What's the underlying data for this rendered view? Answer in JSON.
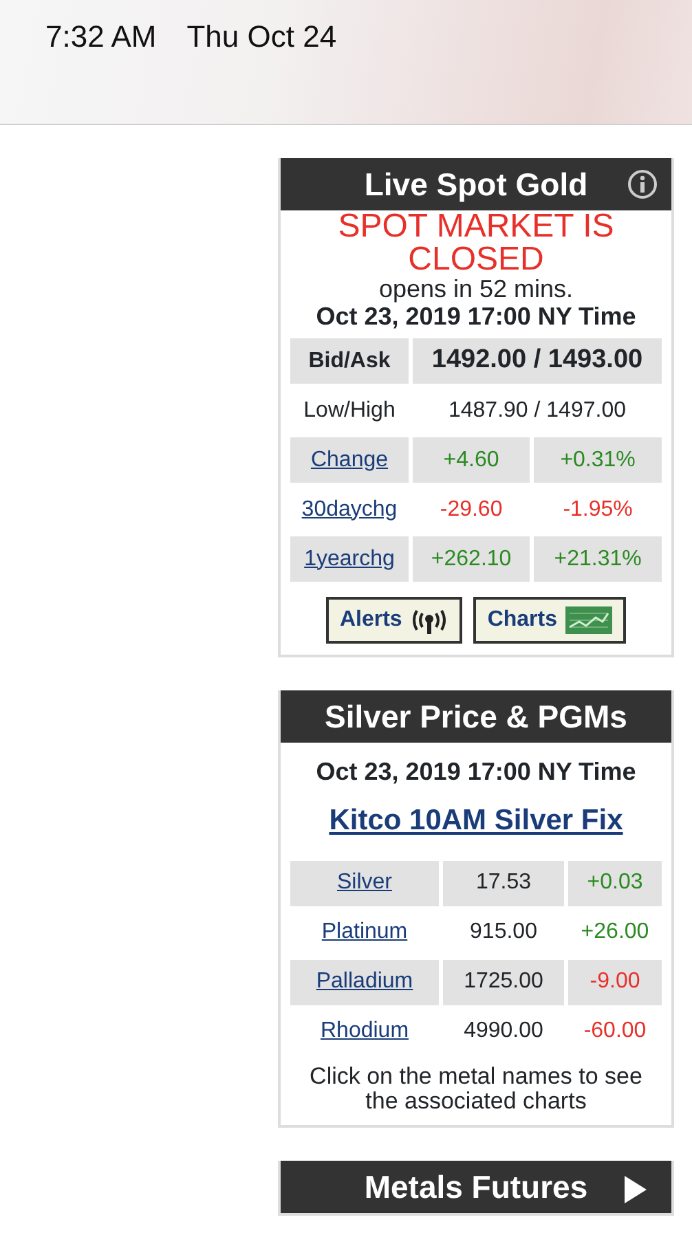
{
  "status_bar": {
    "time": "7:32 AM",
    "date": "Thu Oct 24"
  },
  "gold": {
    "title": "Live Spot Gold",
    "market_status": "SPOT MARKET IS CLOSED",
    "opens_in": "opens in 52 mins.",
    "timestamp": "Oct 23, 2019 17:00 NY Time",
    "rows": [
      {
        "kind": "span",
        "label": "Bid/Ask",
        "link": false,
        "bold": true,
        "value": "1492.00 / 1493.00"
      },
      {
        "kind": "span",
        "label": "Low/High",
        "link": false,
        "bold": false,
        "value": "1487.90 / 1497.00"
      },
      {
        "kind": "split",
        "label": "Change",
        "link": true,
        "values": [
          {
            "text": "+4.60",
            "color": "#2b8a22"
          },
          {
            "text": "+0.31%",
            "color": "#2b8a22"
          }
        ]
      },
      {
        "kind": "split",
        "label": "30daychg",
        "link": true,
        "values": [
          {
            "text": "-29.60",
            "color": "#e8302a"
          },
          {
            "text": "-1.95%",
            "color": "#e8302a"
          }
        ]
      },
      {
        "kind": "split",
        "label": "1yearchg",
        "link": true,
        "values": [
          {
            "text": "+262.10",
            "color": "#2b8a22"
          },
          {
            "text": "+21.31%",
            "color": "#2b8a22"
          }
        ]
      }
    ],
    "buttons": [
      {
        "label": "Alerts",
        "kind": "alerts"
      },
      {
        "label": "Charts",
        "kind": "charts"
      }
    ]
  },
  "silver": {
    "title": "Silver Price & PGMs",
    "timestamp": "Oct 23, 2019 17:00 NY Time",
    "fix_link": "Kitco 10AM Silver Fix",
    "rows": [
      {
        "name": "Silver",
        "price": "17.53",
        "change": "+0.03",
        "color": "#2b8a22"
      },
      {
        "name": "Platinum",
        "price": "915.00",
        "change": "+26.00",
        "color": "#2b8a22"
      },
      {
        "name": "Palladium",
        "price": "1725.00",
        "change": "-9.00",
        "color": "#e8302a"
      },
      {
        "name": "Rhodium",
        "price": "4990.00",
        "change": "-60.00",
        "color": "#e8302a"
      }
    ],
    "note": "Click on the metal names to see the associated charts"
  },
  "futures": {
    "title": "Metals Futures"
  }
}
